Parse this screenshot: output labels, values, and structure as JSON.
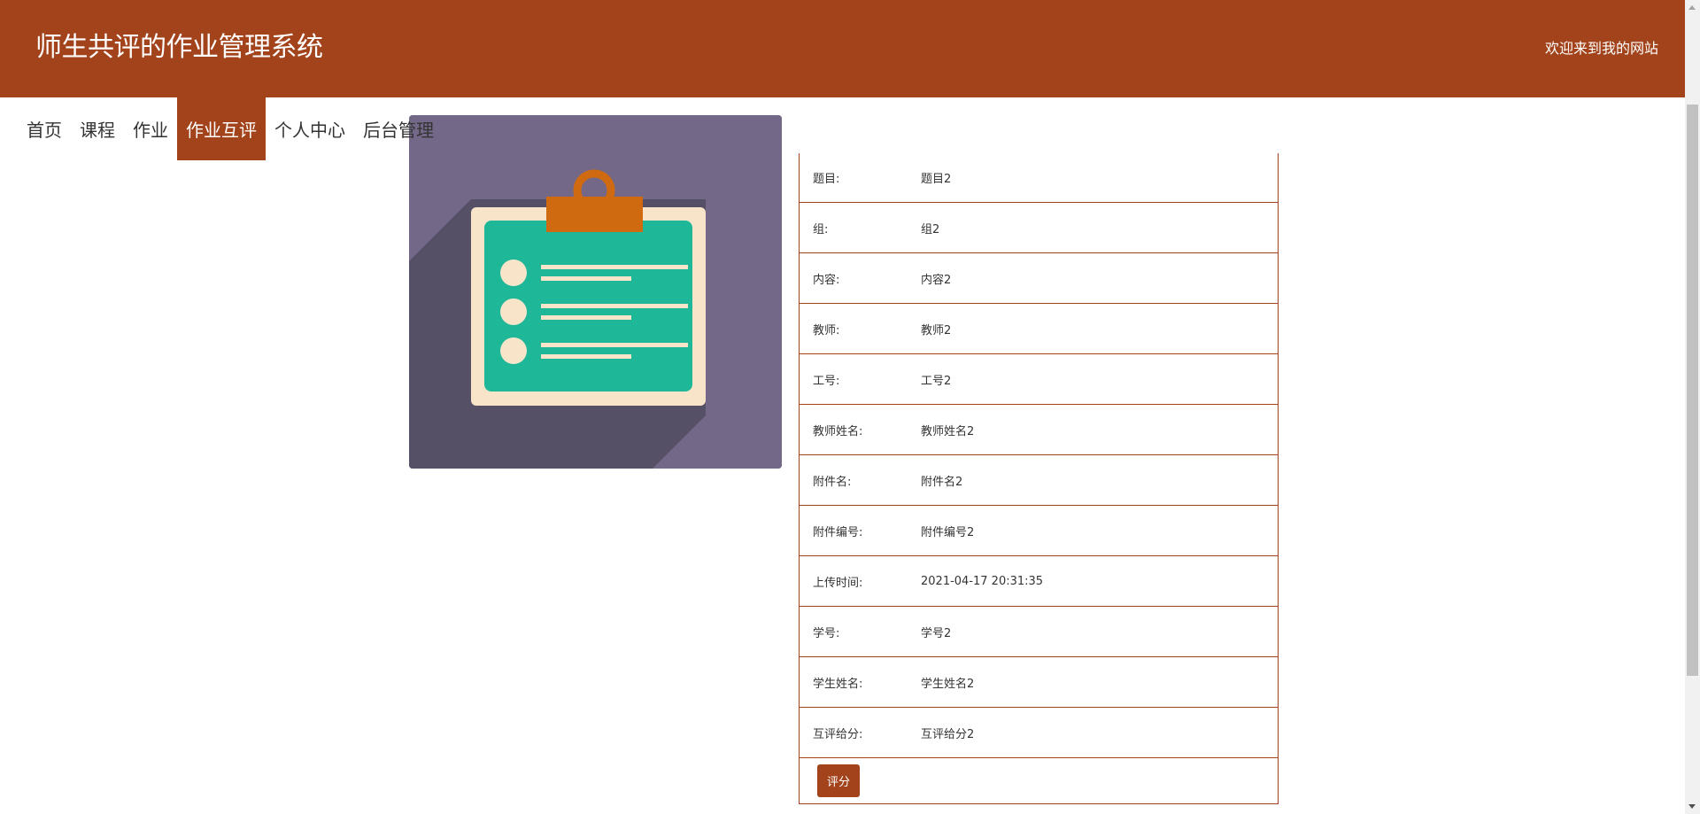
{
  "header": {
    "title": "师生共评的作业管理系统",
    "welcome": "欢迎来到我的网站"
  },
  "nav": {
    "items": [
      {
        "label": "首页"
      },
      {
        "label": "课程"
      },
      {
        "label": "作业"
      },
      {
        "label": "作业互评",
        "active": true
      },
      {
        "label": "个人中心"
      },
      {
        "label": "后台管理"
      }
    ]
  },
  "image": {
    "icon": "clipboard-checklist-icon"
  },
  "detail": {
    "rows": [
      {
        "label": "题目:",
        "value": "题目2"
      },
      {
        "label": "组:",
        "value": "组2"
      },
      {
        "label": "内容:",
        "value": "内容2"
      },
      {
        "label": "教师:",
        "value": "教师2"
      },
      {
        "label": "工号:",
        "value": "工号2"
      },
      {
        "label": "教师姓名:",
        "value": "教师姓名2"
      },
      {
        "label": "附件名:",
        "value": "附件名2"
      },
      {
        "label": "附件编号:",
        "value": "附件编号2"
      },
      {
        "label": "上传时间:",
        "value": "2021-04-17 20:31:35"
      },
      {
        "label": "学号:",
        "value": "学号2"
      },
      {
        "label": "学生姓名:",
        "value": "学生姓名2"
      },
      {
        "label": "互评给分:",
        "value": "互评给分2"
      }
    ],
    "action_label": "评分"
  },
  "colors": {
    "brand": "#a2431b",
    "image_bg": "#736888",
    "clipboard_green": "#1eb899",
    "clipboard_frame": "#f8e4c8",
    "clip_orange": "#d06a10"
  }
}
